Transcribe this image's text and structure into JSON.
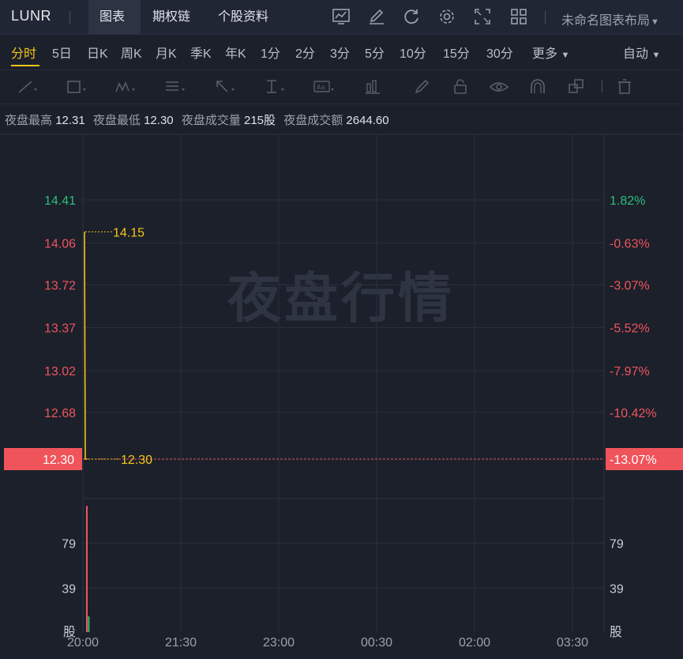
{
  "topbar": {
    "symbol": "LUNR",
    "tabs": [
      {
        "label": "图表",
        "active": true
      },
      {
        "label": "期权链",
        "active": false
      },
      {
        "label": "个股资料",
        "active": false
      }
    ],
    "layout_name": "未命名图表布局",
    "icons": [
      "chart-line-icon",
      "pencil-edit-icon",
      "refresh-icon",
      "gear-icon",
      "fullscreen-icon",
      "grid-layout-icon",
      "chevron-down-icon"
    ]
  },
  "periods": [
    "分时",
    "5日",
    "日K",
    "周K",
    "月K",
    "季K",
    "年K",
    "1分",
    "2分",
    "3分",
    "5分",
    "10分",
    "15分",
    "30分",
    "更多"
  ],
  "active_period": "分时",
  "mode": "自动",
  "draw_tools": [
    "line-tool-icon",
    "rectangle-tool-icon",
    "pattern-tool-icon",
    "fib-tool-icon",
    "arrow-tool-icon",
    "measure-tool-icon",
    "text-tool-icon",
    "indicator-tool-icon",
    "brush-icon",
    "lock-icon",
    "eye-icon",
    "magnet-icon",
    "layers-icon",
    "trash-icon"
  ],
  "info": {
    "high_label": "夜盘最高",
    "high": "12.31",
    "low_label": "夜盘最低",
    "low": "12.30",
    "volume_label": "夜盘成交量",
    "volume": "215股",
    "amount_label": "夜盘成交额",
    "amount": "2644.60"
  },
  "watermark": "夜盘行情",
  "colors": {
    "background": "#1b202b",
    "accent": "#f5c518",
    "up": "#2bbf7a",
    "down": "#f0545b",
    "price_line": "#f5c518"
  },
  "chart_data": {
    "type": "line",
    "price_axis": {
      "ticks": [
        "14.41",
        "14.06",
        "13.72",
        "13.37",
        "13.02",
        "12.68",
        "12.30"
      ],
      "values": [
        14.41,
        14.06,
        13.72,
        13.37,
        13.02,
        12.68,
        12.3
      ],
      "range": [
        12.3,
        14.41
      ]
    },
    "percent_axis": {
      "ticks": [
        "1.82%",
        "-0.63%",
        "-3.07%",
        "-5.52%",
        "-7.97%",
        "-10.42%",
        "-13.07%"
      ]
    },
    "current_price": "12.30",
    "current_percent": "-13.07%",
    "annotations": [
      {
        "label": "14.15",
        "value": 14.15
      },
      {
        "label": "12.30",
        "value": 12.3
      }
    ],
    "x_ticks": [
      "20:00",
      "21:30",
      "23:00",
      "00:30",
      "02:00",
      "03:30"
    ],
    "series": [
      {
        "x": [
          "20:00",
          "20:00",
          "20:01"
        ],
        "y": [
          14.15,
          12.3,
          12.3
        ]
      }
    ],
    "volume_axis": {
      "ticks": [
        "79",
        "39"
      ],
      "unit": "股"
    },
    "volume_bars": [
      {
        "x": "20:00",
        "value": 112,
        "color": "down"
      },
      {
        "x": "20:01",
        "value": 14,
        "color": "up"
      }
    ]
  }
}
